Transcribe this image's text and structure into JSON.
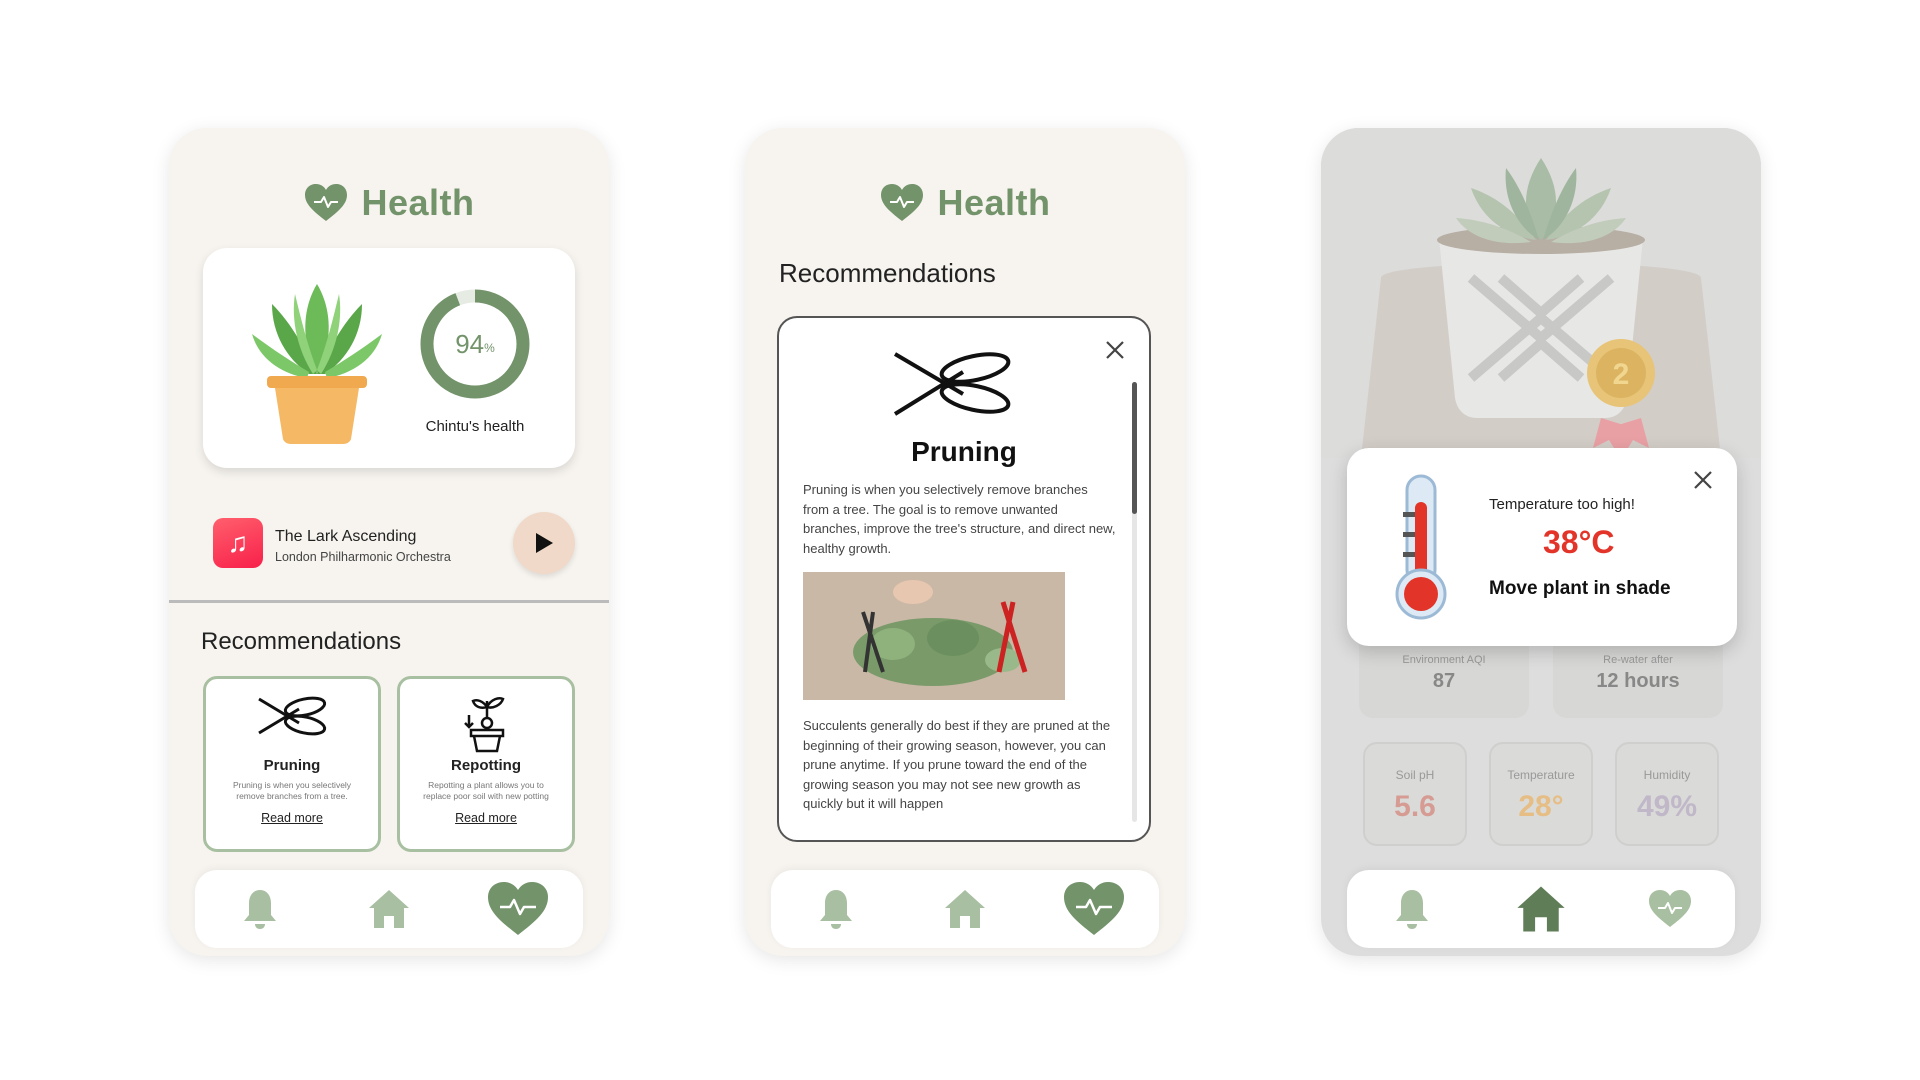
{
  "brand": {
    "primary": "#73936a",
    "primary_dark": "#5f7d57",
    "alert_red": "#e3342a",
    "phone_bg": "#f7f4ef"
  },
  "screen1": {
    "header_title": "Health",
    "plant_health": {
      "percent_value": "94",
      "percent_unit": "%",
      "progress": 0.94,
      "label": "Chintu's health"
    },
    "music": {
      "title": "The Lark Ascending",
      "artist": "London Philharmonic Orchestra"
    },
    "recommendations_title": "Recommendations",
    "cards": [
      {
        "name": "Pruning",
        "desc": "Pruning is when you selectively remove branches from a tree.",
        "link": "Read more"
      },
      {
        "name": "Repotting",
        "desc": "Repotting a plant allows you to replace poor soil with new potting",
        "link": "Read more"
      }
    ],
    "nav": {
      "active": "health"
    }
  },
  "screen2": {
    "header_title": "Health",
    "recommendations_title": "Recommendations",
    "modal": {
      "heading": "Pruning",
      "para1": "Pruning is when you selectively remove branches from a tree. The goal is to remove unwanted branches, improve the tree's structure, and direct new, healthy growth.",
      "para2": "Succulents generally do best if they are pruned at the beginning of their growing season, however, you can prune anytime. If you prune toward the end of the growing season you may not see new growth as quickly but it will happen"
    },
    "nav": {
      "active": "health"
    }
  },
  "screen3": {
    "badge_number": "2",
    "alert": {
      "message": "Temperature too high!",
      "temperature": "38°C",
      "action": "Move plant in shade"
    },
    "metrics_top": [
      {
        "label": "Environment AQI",
        "value": "87"
      },
      {
        "label": "Re-water after",
        "value": "12 hours"
      }
    ],
    "metrics_bottom": [
      {
        "label": "Soil pH",
        "value": "5.6",
        "color": "#d69b93"
      },
      {
        "label": "Temperature",
        "value": "28°",
        "color": "#e6bd84"
      },
      {
        "label": "Humidity",
        "value": "49%",
        "color": "#c0b7c8"
      }
    ],
    "nav": {
      "active": "home"
    }
  }
}
